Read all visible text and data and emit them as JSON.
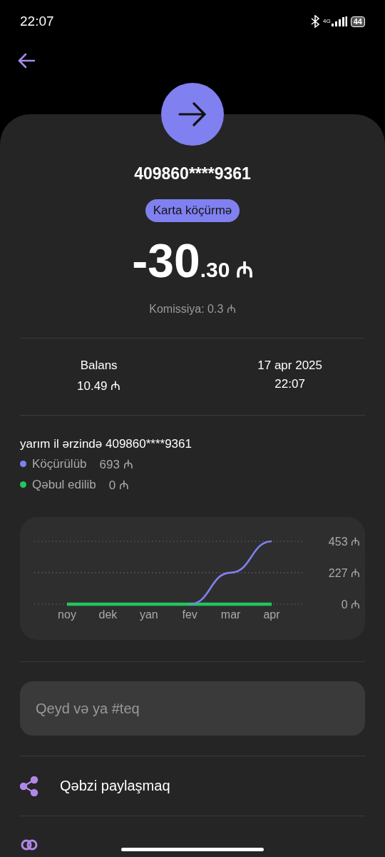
{
  "status_bar": {
    "time": "22:07",
    "network": "4G",
    "battery": "44"
  },
  "header": {
    "account": "409860****9361",
    "category": "Karta köçürmə",
    "amount_main": "-30",
    "amount_fraction": ".30 ₼",
    "commission": "Komissiya: 0.3 ₼"
  },
  "details": [
    {
      "label": "Balans",
      "value": "10.49 ₼"
    },
    {
      "label": "17 apr 2025",
      "value": "22:07"
    }
  ],
  "summary": {
    "title": "yarım il ərzində 409860****9361",
    "legend": [
      {
        "value": "693 ₼"
      },
      {
        "value": "0 ₼"
      }
    ],
    "chart_data": {
      "type": "line",
      "categories": [
        "noy",
        "dek",
        "yan",
        "fev",
        "mar",
        "apr"
      ],
      "yticks": [
        {
          "value": 0,
          "label": "0 ₼"
        },
        {
          "value": 227,
          "label": "227 ₼"
        },
        {
          "value": 453,
          "label": "453 ₼"
        }
      ],
      "ylim": [
        0,
        453
      ],
      "series": [
        {
          "name": "Köçürülüb",
          "color": "#8080f0",
          "values": [
            null,
            null,
            null,
            0,
            227,
            453
          ]
        },
        {
          "name": "Qəbul edilib",
          "color": "#22c55e",
          "values": [
            0,
            0,
            0,
            0,
            0,
            0
          ]
        }
      ]
    }
  },
  "note": {
    "placeholder": "Qeyd və ya #teq"
  },
  "actions": [
    {
      "label": "Qəbzi paylaşmaq",
      "kind": "share"
    },
    {
      "kind": "split"
    }
  ]
}
